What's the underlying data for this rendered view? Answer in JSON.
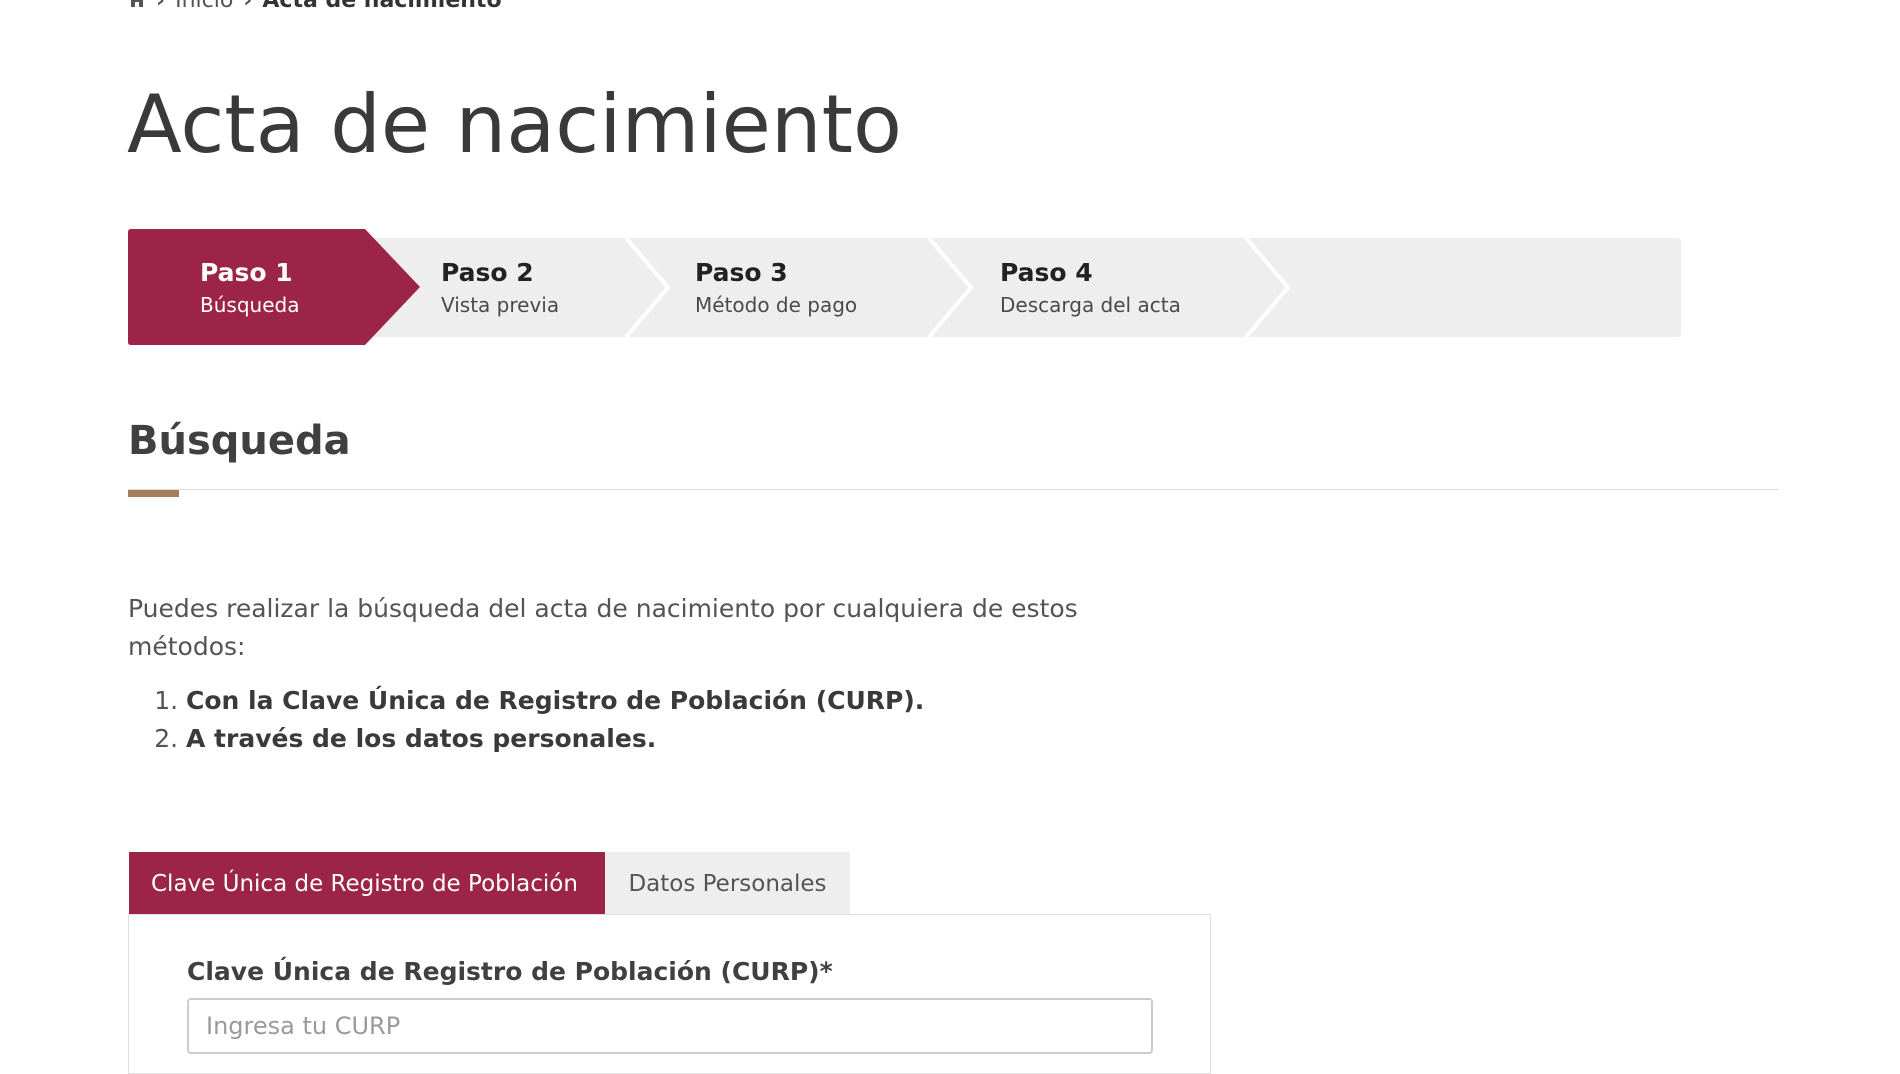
{
  "breadcrumb": {
    "home_icon": "home-icon",
    "home_label": "Inicio",
    "separator": "›",
    "current": "Acta de nacimiento"
  },
  "page_title": "Acta de nacimiento",
  "stepper": {
    "active_color": "#9d2449",
    "steps": [
      {
        "num": "Paso 1",
        "label": "Búsqueda",
        "active": true
      },
      {
        "num": "Paso 2",
        "label": "Vista previa",
        "active": false
      },
      {
        "num": "Paso 3",
        "label": "Método de pago",
        "active": false
      },
      {
        "num": "Paso 4",
        "label": "Descarga del acta",
        "active": false
      }
    ]
  },
  "section": {
    "title": "Búsqueda",
    "accent_color": "#a57f58",
    "intro": "Puedes realizar la búsqueda del acta de nacimiento por cualquiera de estos métodos:",
    "methods": [
      "Con la Clave Única de Registro de Población (CURP).",
      "A través de los datos personales."
    ]
  },
  "tabs": [
    {
      "label": "Clave Única de Registro de Población",
      "active": true
    },
    {
      "label": "Datos Personales",
      "active": false
    }
  ],
  "form": {
    "curp_label": "Clave Única de Registro de Población (CURP)*",
    "curp_placeholder": "Ingresa tu CURP",
    "curp_value": ""
  }
}
